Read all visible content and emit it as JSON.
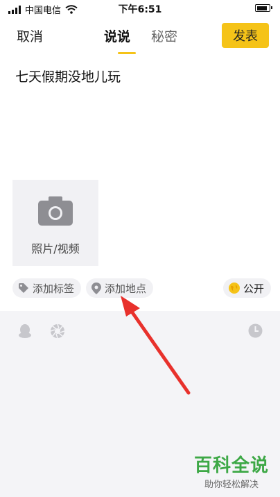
{
  "status_bar": {
    "carrier": "中国电信",
    "time": "下午6:51",
    "battery_level": 0.9
  },
  "nav": {
    "cancel_label": "取消",
    "tabs": [
      {
        "label": "说说",
        "active": true
      },
      {
        "label": "秘密",
        "active": false
      }
    ],
    "publish_label": "发表"
  },
  "post": {
    "text": "七天假期没地儿玩"
  },
  "media": {
    "photo_video_label": "照片/视频"
  },
  "chips": {
    "add_tag": "添加标签",
    "add_location": "添加地点",
    "visibility": "公开"
  },
  "watermark": {
    "title": "百科全说",
    "subtitle": "助你轻松解决"
  },
  "colors": {
    "accent": "#f5c318",
    "arrow": "#e8312c",
    "watermark": "#3da846"
  }
}
